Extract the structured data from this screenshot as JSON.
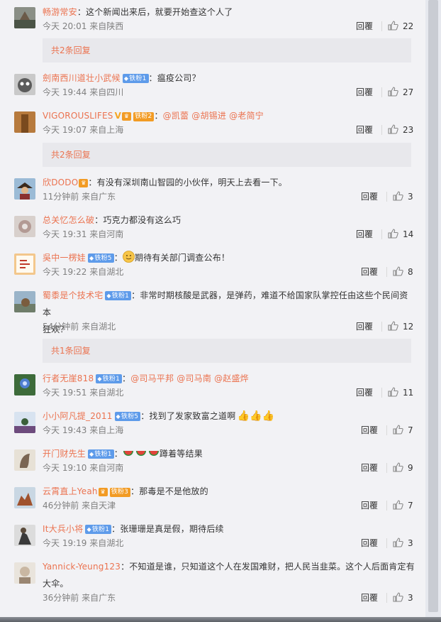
{
  "comments": [
    {
      "user": "畅游常安",
      "text": "：这个新闻出来后，就要开始查这个人了",
      "time": "今天 20:01 来自陕西",
      "reply": "回覆",
      "likes": "22",
      "replies": "共2条回复"
    },
    {
      "user": "劍南西川道壮小武候",
      "badge": "铁粉1",
      "text": "：瘟疫公司？",
      "time": "今天 19:44 来自四川",
      "reply": "回覆",
      "likes": "27"
    },
    {
      "user": "VIGOROUSLIFES",
      "vmark": "V",
      "badge": "铁粉2",
      "mentions": [
        "@凯蕾",
        "@胡锡进",
        "@老简宁"
      ],
      "time": "今天 19:07 来自上海",
      "reply": "回覆",
      "likes": "23",
      "replies": "共2条回复"
    },
    {
      "user": "欣DODO",
      "text": "：有没有深圳南山智园的小伙伴，明天上去看一下。",
      "time": "11分钟前 来自广东",
      "reply": "回覆",
      "likes": "3"
    },
    {
      "user": "总关忆怎么破",
      "text": "：巧克力都没有这么巧",
      "time": "今天 19:31 来自河南",
      "reply": "回覆",
      "likes": "14"
    },
    {
      "user": "吳中一楞娃",
      "badge": "铁粉5",
      "text": "期待有关部门调查公布！",
      "time": "今天 19:22 来自湖北",
      "reply": "回覆",
      "likes": "8"
    },
    {
      "user": "蜀黍是个技术宅",
      "badge": "铁粉1",
      "text": "：非常时期核酸是武器，是弹药，难道不给国家队掌控任由这些个民间资本",
      "text2": "狂欢？",
      "time": "54分钟前 来自湖北",
      "reply": "回覆",
      "likes": "12",
      "replies": "共1条回复"
    },
    {
      "user": "行者无崖818",
      "badge": "铁粉1",
      "mentions": [
        "@司马平邦",
        "@司马南",
        "@赵盛烨"
      ],
      "time": "今天 19:51 来自湖北",
      "reply": "回覆",
      "likes": "11"
    },
    {
      "user": "小小阿凡提_2011",
      "badge": "铁粉5",
      "text": "：找到了发家致富之道啊",
      "time": "今天 19:43 来自上海",
      "reply": "回覆",
      "likes": "7"
    },
    {
      "user": "开门财先生",
      "badge": "铁粉1",
      "text": "蹲着等结果",
      "time": "今天 19:10 来自河南",
      "reply": "回覆",
      "likes": "9"
    },
    {
      "user": "云霄直上Yeah",
      "badge": "铁粉3",
      "text": "：那毒是不是他放的",
      "time": "46分钟前 来自天津",
      "reply": "回覆",
      "likes": "7"
    },
    {
      "user": "It大兵小将",
      "badge": "铁粉1",
      "text": "：张珊珊是真是假，期待后续",
      "time": "今天 19:19 来自湖北",
      "reply": "回覆",
      "likes": "3"
    },
    {
      "user": "Yannick-Yeung123",
      "text": "：不知道是谁，只知道这个人在发国难财，把人民当韭菜。这个人后面肯定有",
      "text2": "大伞。",
      "time": "36分钟前 来自广东",
      "reply": "回覆",
      "likes": "3"
    }
  ],
  "colors": {
    "username": "#eb7350",
    "badge": "#5e9bea",
    "background": "#f2f2f5"
  }
}
